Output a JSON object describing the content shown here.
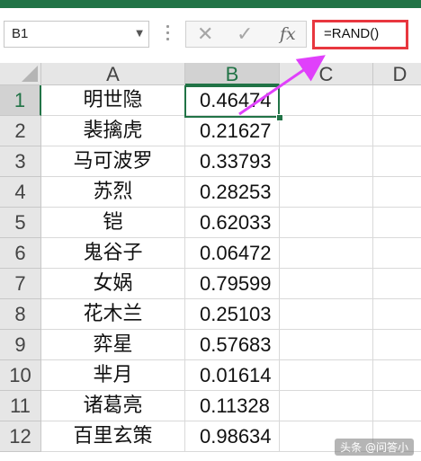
{
  "name_box": {
    "value": "B1",
    "arrow_icon": "chevron-down-icon"
  },
  "formula_bar": {
    "cancel_icon": "close-icon",
    "enter_icon": "check-icon",
    "function_icon": "fx-icon",
    "function_label": "fx",
    "formula": "=RAND()"
  },
  "columns": [
    "A",
    "B",
    "C",
    "D"
  ],
  "active_column": "B",
  "active_row": "1",
  "rows": [
    {
      "row": "1",
      "name": "明世隐",
      "value": "0.46474"
    },
    {
      "row": "2",
      "name": "裴擒虎",
      "value": "0.21627"
    },
    {
      "row": "3",
      "name": "马可波罗",
      "value": "0.33793"
    },
    {
      "row": "4",
      "name": "苏烈",
      "value": "0.28253"
    },
    {
      "row": "5",
      "name": "铠",
      "value": "0.62033"
    },
    {
      "row": "6",
      "name": "鬼谷子",
      "value": "0.06472"
    },
    {
      "row": "7",
      "name": "女娲",
      "value": "0.79599"
    },
    {
      "row": "8",
      "name": "花木兰",
      "value": "0.25103"
    },
    {
      "row": "9",
      "name": "弈星",
      "value": "0.57683"
    },
    {
      "row": "10",
      "name": "芈月",
      "value": "0.01614"
    },
    {
      "row": "11",
      "name": "诸葛亮",
      "value": "0.11328"
    },
    {
      "row": "12",
      "name": "百里玄策",
      "value": "0.98634"
    }
  ],
  "annotation": {
    "arrow_color": "#e040fb",
    "highlight_color": "#e8373f"
  },
  "watermark": "头条 @问答小"
}
